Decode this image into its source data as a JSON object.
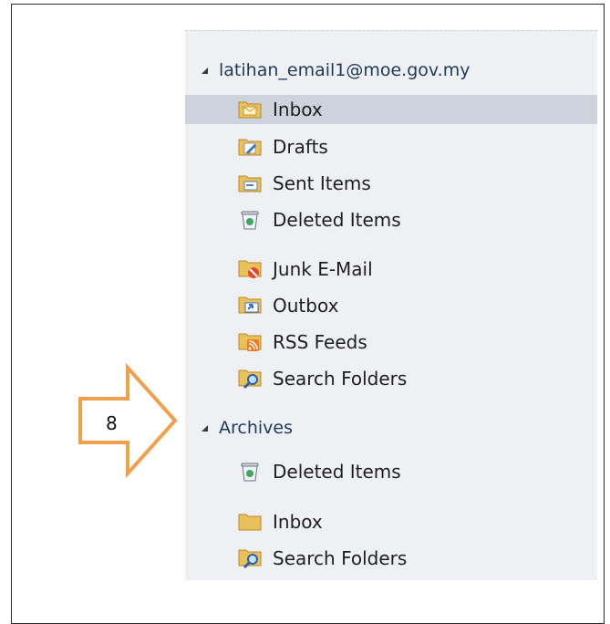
{
  "account": {
    "email": "latihan_email1@moe.gov.my"
  },
  "mail_folders": [
    {
      "label": "Inbox",
      "icon": "inbox-folder-icon",
      "selected": true
    },
    {
      "label": "Drafts",
      "icon": "drafts-folder-icon",
      "selected": false
    },
    {
      "label": "Sent Items",
      "icon": "sent-items-folder-icon",
      "selected": false
    },
    {
      "label": "Deleted Items",
      "icon": "deleted-items-icon",
      "selected": false
    },
    {
      "label": "Junk E-Mail",
      "icon": "junk-email-folder-icon",
      "selected": false
    },
    {
      "label": "Outbox",
      "icon": "outbox-folder-icon",
      "selected": false
    },
    {
      "label": "RSS Feeds",
      "icon": "rss-feeds-folder-icon",
      "selected": false
    },
    {
      "label": "Search Folders",
      "icon": "search-folders-icon",
      "selected": false
    }
  ],
  "archives": {
    "label": "Archives",
    "folders": [
      {
        "label": "Deleted Items",
        "icon": "deleted-items-icon"
      },
      {
        "label": "Inbox",
        "icon": "inbox-folder-icon"
      },
      {
        "label": "Search Folders",
        "icon": "search-folders-icon"
      }
    ]
  },
  "callout": {
    "number": "8",
    "color": "#f0a04b"
  },
  "colors": {
    "pane_bg": "#eef0f4",
    "selected_bg": "#cdd3dd",
    "header_text": "#1e395b"
  }
}
